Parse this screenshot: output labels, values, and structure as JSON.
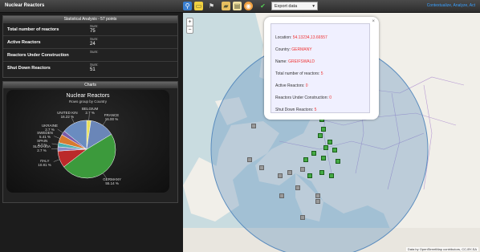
{
  "app": {
    "title": "Nuclear Reactors"
  },
  "toolbar": {
    "export_value": "Export data",
    "link": "Contextualize, Analyze, Act"
  },
  "stats": {
    "header": "Statistical Analysis - 57 points",
    "sum_label": "Sum:",
    "rows": [
      {
        "label": "Total number of reactors",
        "value": "75"
      },
      {
        "label": "Active Reactors",
        "value": "24"
      },
      {
        "label": "Reactors Under Construction",
        "value": ""
      },
      {
        "label": "Shut Down Reactors",
        "value": "51"
      }
    ]
  },
  "charts": {
    "header": "Charts"
  },
  "chart_data": {
    "type": "pie",
    "title": "Nuclear Reactors",
    "subtitle": "Rows group by Country",
    "slices": [
      {
        "name": "BELGIUM",
        "value": 2.7,
        "label": "2.7 %",
        "color": "#e8e05a"
      },
      {
        "name": "FRANCE",
        "value": 16.0,
        "label": "16.00 %",
        "color": "#6a86b8"
      },
      {
        "name": "GERMANY",
        "value": 55.14,
        "label": "55.14 %",
        "color": "#3c9a3c"
      },
      {
        "name": "ITALY",
        "value": 10.81,
        "label": "10.81 %",
        "color": "#bb2a2a"
      },
      {
        "name": "SLOVAKIA",
        "value": 2.7,
        "label": "2.7 %",
        "color": "#8a8ac6"
      },
      {
        "name": "SPAIN",
        "value": 2.7,
        "label": "2.7 %",
        "color": "#4cb0b0"
      },
      {
        "name": "SWEDEN",
        "value": 5.41,
        "label": "5.41 %",
        "color": "#d77a30"
      },
      {
        "name": "UKRAINE",
        "value": 2.7,
        "label": "2.7 %",
        "color": "#7c5ca8"
      },
      {
        "name": "UNITED KIN",
        "value": 16.22,
        "label": "16.22 %",
        "color": "#6a8cc0"
      }
    ]
  },
  "popup": {
    "rows": [
      {
        "key": "Location: ",
        "val": "54.13234,13.66557"
      },
      {
        "key": "Country: ",
        "val": "GERMANY"
      },
      {
        "key": "Name: ",
        "val": "GREIFSWALD"
      },
      {
        "key": "Total number of reactors: ",
        "val": "5"
      },
      {
        "key": "Active Reactors: ",
        "val": "0"
      },
      {
        "key": "Reactors Under Construction: ",
        "val": "0"
      },
      {
        "key": "Shut Down Reactors: ",
        "val": "5"
      }
    ],
    "close": "×"
  },
  "map": {
    "zoom_in": "+",
    "zoom_out": "−",
    "attribution": "Data by OpenStreetMap contributors, CC-BY-SA"
  }
}
